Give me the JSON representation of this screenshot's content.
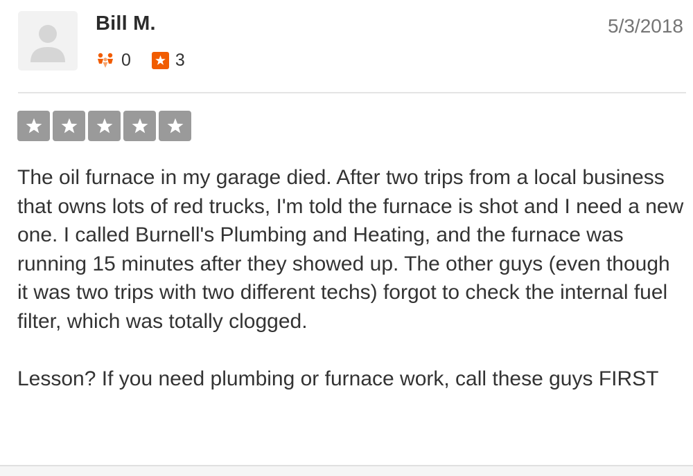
{
  "review": {
    "user": {
      "name": "Bill M.",
      "avatar_icon": "user-silhouette-icon",
      "friends_icon": "friends-icon",
      "friends_count": "0",
      "reviews_icon": "review-star-icon",
      "reviews_count": "3"
    },
    "date": "5/3/2018",
    "rating": {
      "value": 0,
      "max": 5,
      "empty_color": "#9a9a9a"
    },
    "paragraphs": [
      "The oil furnace in my garage died. After two trips from a local business that owns lots of red trucks, I'm told the furnace is shot and I need a new one. I called Burnell's Plumbing and Heating, and the furnace was running 15 minutes after they showed up. The other guys (even though it was two trips with two different techs) forgot to check the internal fuel filter, which was totally clogged.",
      "Lesson? If you need plumbing or furnace work, call these guys FIRST"
    ]
  },
  "colors": {
    "accent_orange": "#f15c00",
    "text": "#333333",
    "muted": "#757575"
  }
}
